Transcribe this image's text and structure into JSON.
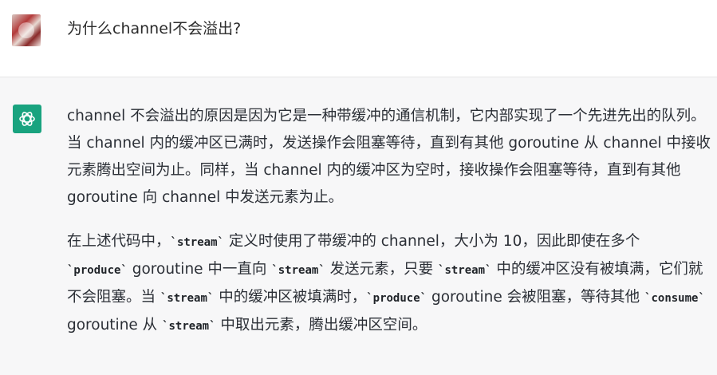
{
  "user": {
    "avatar_icon": "user-avatar",
    "message": "为什么channel不会溢出?"
  },
  "assistant": {
    "icon": "chatgpt-logo-icon",
    "icon_color": "#19a37f",
    "paragraph1": "channel 不会溢出的原因是因为它是一种带缓冲的通信机制，它内部实现了一个先进先出的队列。当 channel 内的缓冲区已满时，发送操作会阻塞等待，直到有其他 goroutine 从 channel 中接收元素腾出空间为止。同样，当 channel 内的缓冲区为空时，接收操作会阻塞等待，直到有其他 goroutine 向 channel 中发送元素为止。",
    "p2": {
      "t1": "在上述代码中，",
      "c1": "`stream`",
      "t2": " 定义时使用了带缓冲的 channel，大小为 10，因此即使在多个",
      "c2": "`produce`",
      "t3": " goroutine 中一直向 ",
      "c3": "`stream`",
      "t4": " 发送元素，只要 ",
      "c4": "`stream`",
      "t5": " 中的缓冲区没有被填满，它们就不会阻塞。当 ",
      "c5": "`stream`",
      "t6": " 中的缓冲区被填满时，",
      "c6": "`produce`",
      "t7": " goroutine 会被阻塞，等待其他 ",
      "c7": "`consume`",
      "t8": " goroutine 从 ",
      "c8": "`stream`",
      "t9": " 中取出元素，腾出缓冲区空间。"
    }
  }
}
